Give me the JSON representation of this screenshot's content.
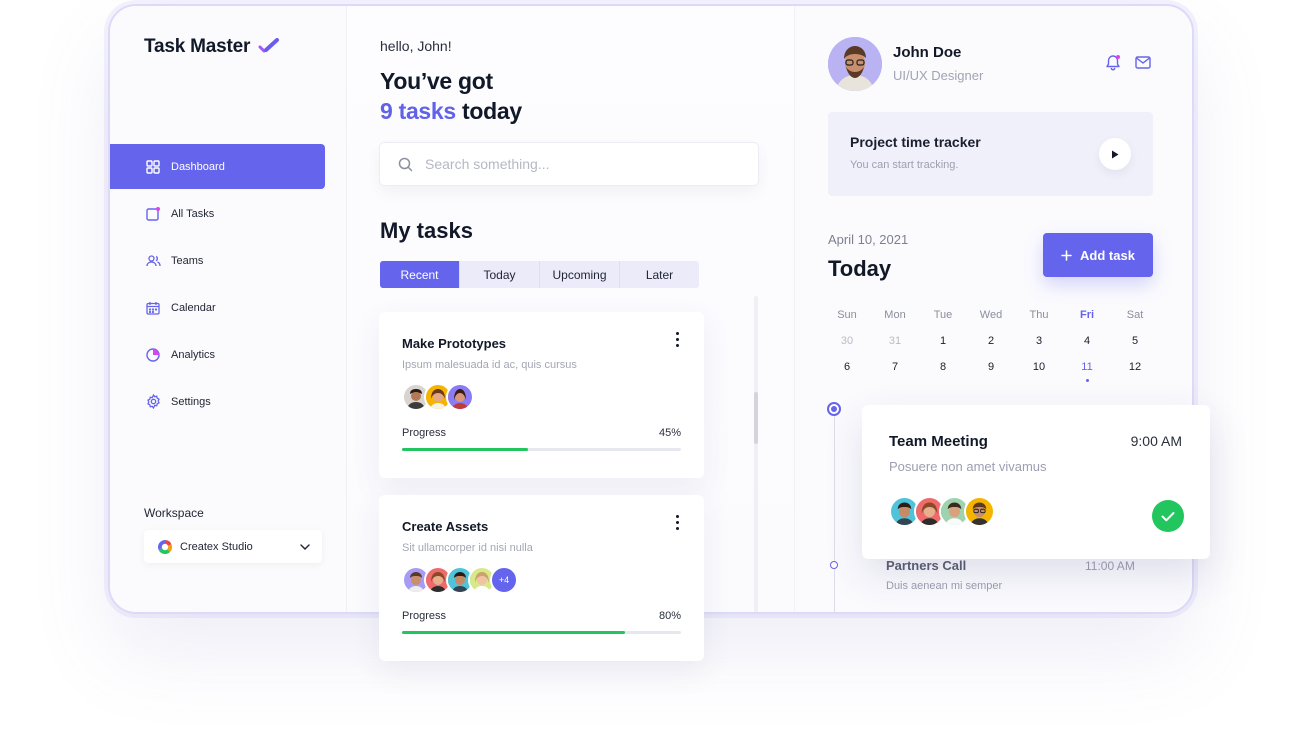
{
  "brand": {
    "name": "Task Master",
    "logo_icon": "check-pen-icon",
    "accent": "#6464ec"
  },
  "sidebar": {
    "items": [
      {
        "label": "Dashboard",
        "icon": "grid-icon",
        "active": true
      },
      {
        "label": "All Tasks",
        "icon": "tasks-icon",
        "active": false
      },
      {
        "label": "Teams",
        "icon": "users-icon",
        "active": false
      },
      {
        "label": "Calendar",
        "icon": "calendar-icon",
        "active": false
      },
      {
        "label": "Analytics",
        "icon": "pie-chart-icon",
        "active": false
      },
      {
        "label": "Settings",
        "icon": "gear-icon",
        "active": false
      }
    ],
    "workspace_label": "Workspace",
    "workspace_value": "Createx Studio"
  },
  "main": {
    "greeting": "hello, John!",
    "headline_line1": "You’ve got",
    "headline_count": "9 tasks",
    "headline_suffix": "today",
    "search_placeholder": "Search something...",
    "section_title": "My tasks",
    "tabs": [
      "Recent",
      "Today",
      "Upcoming",
      "Later"
    ],
    "tasks": [
      {
        "title": "Make Prototypes",
        "subtitle": "Ipsum malesuada id ac, quis cursus",
        "progress_label": "Progress",
        "progress": 45,
        "progress_text": "45%",
        "extra_members": ""
      },
      {
        "title": "Create Assets",
        "subtitle": "Sit ullamcorper id nisi nulla",
        "progress_label": "Progress",
        "progress": 80,
        "progress_text": "80%",
        "extra_members": "+4"
      }
    ]
  },
  "profile": {
    "name": "John Doe",
    "role": "UI/UX Designer"
  },
  "tracker": {
    "title": "Project time tracker",
    "subtitle": "You can start tracking."
  },
  "schedule": {
    "date": "April 10, 2021",
    "title": "Today",
    "add_label": "Add task",
    "weekdays": [
      "Sun",
      "Mon",
      "Tue",
      "Wed",
      "Thu",
      "Fri",
      "Sat"
    ],
    "week1": [
      "30",
      "31",
      "1",
      "2",
      "3",
      "4",
      "5"
    ],
    "week2": [
      "6",
      "7",
      "8",
      "9",
      "10",
      "11",
      "12"
    ],
    "selected_day": "11",
    "events": [
      {
        "title": "Team Meeting",
        "time": "9:00 AM",
        "subtitle": "Posuere non amet vivamus",
        "done": true
      },
      {
        "title": "Partners Call",
        "time": "11:00 AM",
        "subtitle": "Duis aenean mi semper"
      }
    ]
  },
  "colors": {
    "primary": "#6464ec",
    "success": "#22c55e"
  }
}
